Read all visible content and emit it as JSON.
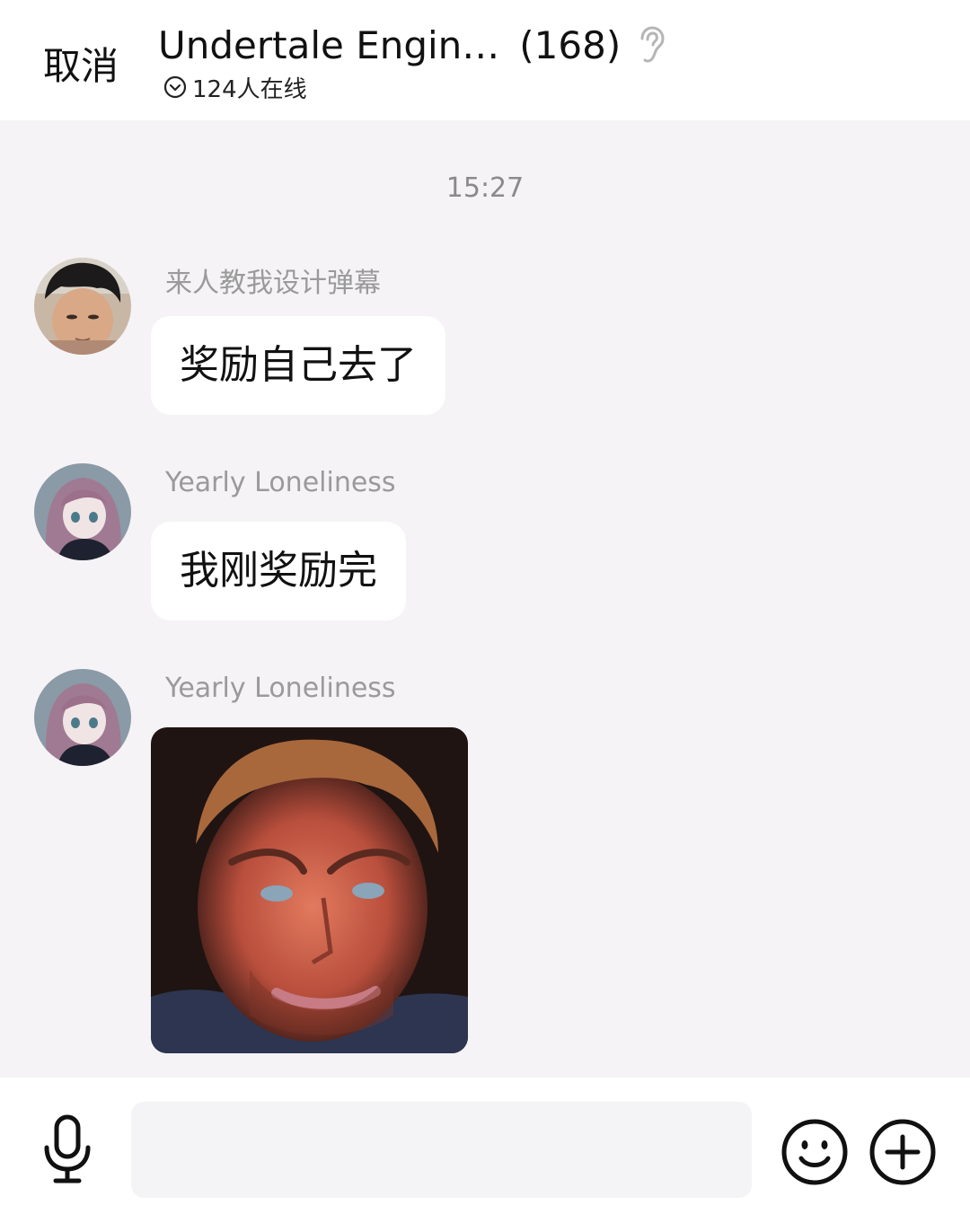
{
  "header": {
    "cancel_label": "取消",
    "title": "Undertale Engin…",
    "member_count": "(168)",
    "online_text": "124人在线"
  },
  "chat": {
    "timestamp": "15:27",
    "messages": [
      {
        "sender": "来人教我设计弹幕",
        "text": "奖励自己去了",
        "avatar": "avatar-boy"
      },
      {
        "sender": "Yearly Loneliness",
        "text": "我刚奖励完",
        "avatar": "avatar-anime-girl"
      },
      {
        "sender": "Yearly Loneliness",
        "type": "image",
        "image": "photo-man-face",
        "avatar": "avatar-anime-girl"
      }
    ]
  },
  "input": {
    "value": "",
    "placeholder": ""
  },
  "icons": {
    "earpiece": "ear-icon",
    "online_toggle": "chevron-down-circle-icon",
    "voice": "microphone-icon",
    "emoji": "emoji-icon",
    "more": "plus-circle-icon"
  },
  "colors": {
    "background": "#f5f3f6",
    "bubble": "#ffffff",
    "sender_text": "#9a9a9a"
  }
}
